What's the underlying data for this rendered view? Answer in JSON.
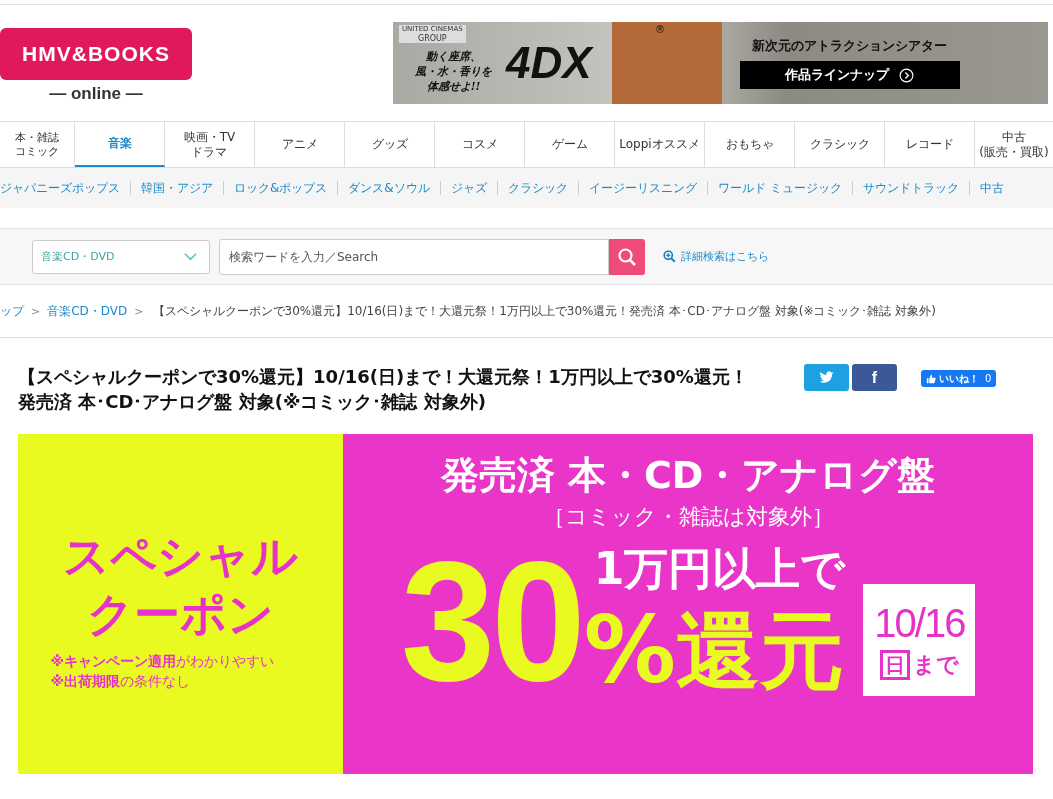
{
  "logo": {
    "brand": "HMV&BOOKS",
    "sub": "— online —"
  },
  "ad": {
    "group": "UNITED CINEMAS",
    "group_sub": "GROUP",
    "catch": [
      "動く座席、",
      "風・水・香りを",
      "体感せよ!!"
    ],
    "product": "4DX",
    "mark": "®",
    "headline": "新次元のアトラクションシアター",
    "button": "作品ラインナップ"
  },
  "nav_tabs": [
    {
      "lines": [
        "本・雑誌",
        "コミック"
      ],
      "selected": false,
      "small": true
    },
    {
      "lines": [
        "音楽"
      ],
      "selected": true,
      "small": false
    },
    {
      "lines": [
        "映画・TV",
        "ドラマ"
      ],
      "selected": false,
      "small": false
    },
    {
      "lines": [
        "アニメ"
      ],
      "selected": false,
      "small": false
    },
    {
      "lines": [
        "グッズ"
      ],
      "selected": false,
      "small": false
    },
    {
      "lines": [
        "コスメ"
      ],
      "selected": false,
      "small": false
    },
    {
      "lines": [
        "ゲーム"
      ],
      "selected": false,
      "small": false
    },
    {
      "lines": [
        "Loppiオススメ"
      ],
      "selected": false,
      "small": false
    },
    {
      "lines": [
        "おもちゃ"
      ],
      "selected": false,
      "small": false
    },
    {
      "lines": [
        "クラシック"
      ],
      "selected": false,
      "small": false
    },
    {
      "lines": [
        "レコード"
      ],
      "selected": false,
      "small": false
    },
    {
      "lines": [
        "中古",
        "(販売・買取)"
      ],
      "selected": false,
      "small": false
    }
  ],
  "sub_nav": [
    "ジャパニーズポップス",
    "韓国・アジア",
    "ロック&ポップス",
    "ダンス&ソウル",
    "ジャズ",
    "クラシック",
    "イージーリスニング",
    "ワールド ミュージック",
    "サウンドトラック",
    "中古"
  ],
  "search": {
    "category": "音楽CD・DVD",
    "placeholder": "検索ワードを入力／Search",
    "advanced": "詳細検索はこちら"
  },
  "breadcrumb": [
    {
      "label": "ップ",
      "link": true
    },
    {
      "sep": ">",
      "label": "音楽CD・DVD",
      "link": true
    },
    {
      "sep": ">",
      "label": "【スペシャルクーポンで30%還元】10/16(日)まで！大還元祭！1万円以上で30%還元！発売済 本･CD･アナログ盤 対象(※コミック･雑誌 対象外)",
      "link": false
    }
  ],
  "title": "【スペシャルクーポンで30%還元】10/16(日)まで！大還元祭！1万円以上で30%還元！発売済 本･CD･アナログ盤 対象(※コミック･雑誌 対象外)",
  "share": {
    "facebook": "f",
    "like_label": "いいね！",
    "like_count": "0"
  },
  "banner": {
    "left_title": [
      "スペシャル",
      "クーポン"
    ],
    "notes": [
      {
        "strong": "※キャンペーン適用",
        "rest": "がわかりやすい"
      },
      {
        "strong": "※出荷期限",
        "rest": "の条件なし"
      }
    ],
    "target": "発売済 本・CD・アナログ盤",
    "exclude": "［コミック・雑誌は対象外］",
    "big": "30",
    "percent": "%",
    "condition": "1万円以上で",
    "reward": "還元",
    "date": "10/16",
    "day": "日",
    "until": "まで"
  }
}
